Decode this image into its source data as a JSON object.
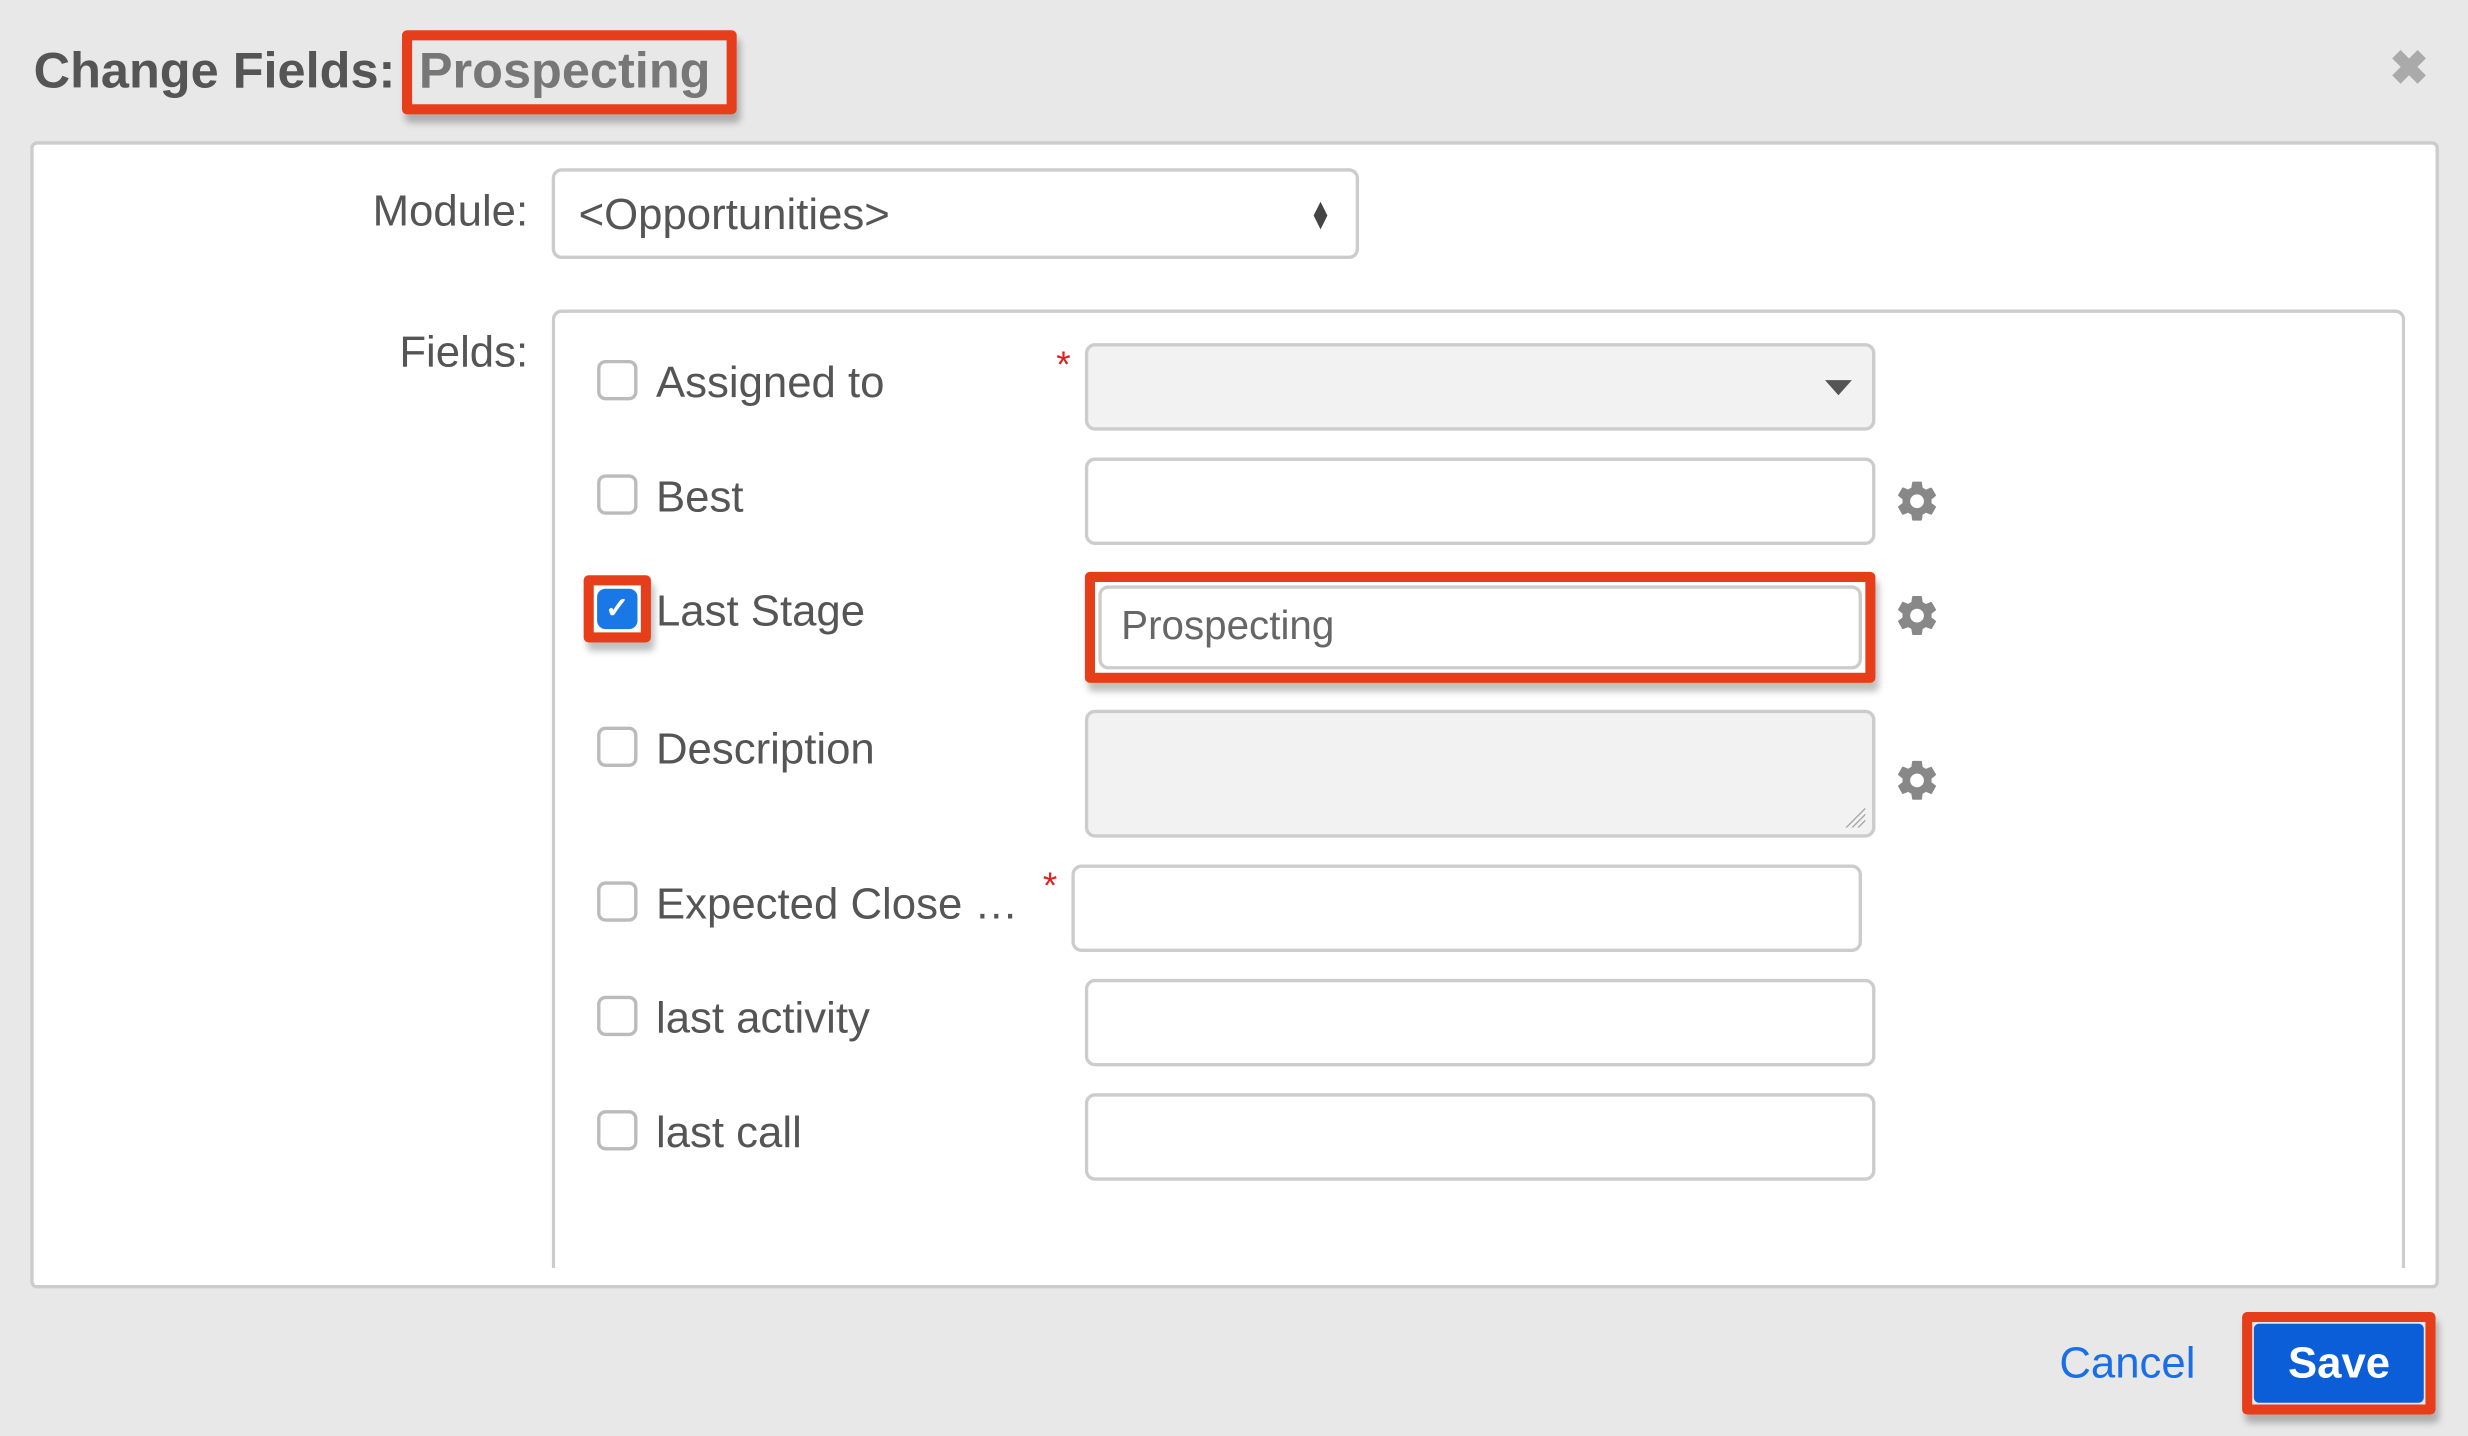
{
  "header": {
    "title_prefix": "Change Fields:",
    "title_highlight": "Prospecting"
  },
  "module": {
    "label": "Module:",
    "selected": "<Opportunities>"
  },
  "fields_label": "Fields:",
  "fields": [
    {
      "name": "Assigned to",
      "checked": false,
      "required": true,
      "value": "",
      "type": "dropdown",
      "gear": false,
      "highlighted": false
    },
    {
      "name": "Best",
      "checked": false,
      "required": false,
      "value": "",
      "type": "text",
      "gear": true,
      "highlighted": false
    },
    {
      "name": "Last Stage",
      "checked": true,
      "required": false,
      "value": "Prospecting",
      "type": "text",
      "gear": true,
      "highlighted": true
    },
    {
      "name": "Description",
      "checked": false,
      "required": false,
      "value": "",
      "type": "textarea",
      "gear": true,
      "highlighted": false
    },
    {
      "name": "Expected Close D...",
      "checked": false,
      "required": true,
      "value": "",
      "type": "text",
      "gear": false,
      "highlighted": false
    },
    {
      "name": "last activity",
      "checked": false,
      "required": false,
      "value": "",
      "type": "text",
      "gear": false,
      "highlighted": false
    },
    {
      "name": "last call",
      "checked": false,
      "required": false,
      "value": "",
      "type": "text",
      "gear": false,
      "highlighted": false
    }
  ],
  "footer": {
    "cancel": "Cancel",
    "save": "Save"
  }
}
